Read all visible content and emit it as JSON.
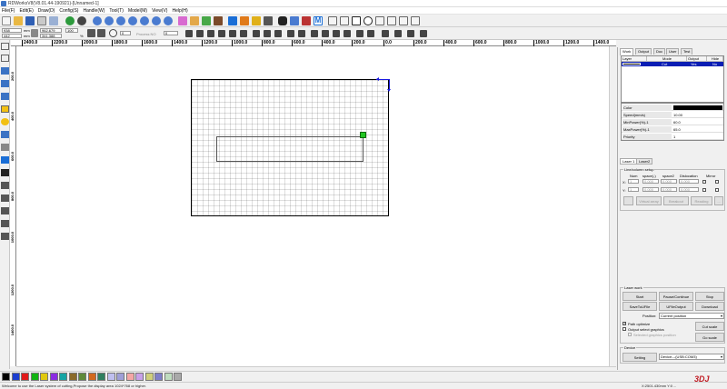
{
  "window": {
    "title": "RDWorksV8(V8.01.44-190921)-[Unnamed-1]"
  },
  "menu": [
    "File(F)",
    "Edit(E)",
    "Draw(D)",
    "Config(S)",
    "Handle(W)",
    "Tool(T)",
    "Model(M)",
    "View(V)",
    "Help(H)"
  ],
  "toolbar2": {
    "pos_x": "938",
    "pos_y": "442",
    "unit1": "mm",
    "unit2": "mm",
    "size_x": "962.679",
    "size_y": "341.388",
    "pct_x": "100",
    "pct_y": "%",
    "rotate_value": "0",
    "process_no_label": "Process NO",
    "process_no_value": "0"
  },
  "hruler": [
    "2400.0",
    "2200.0",
    "2000.0",
    "1800.0",
    "1600.0",
    "1400.0",
    "1200.0",
    "1000.0",
    "800.0",
    "600.0",
    "400.0",
    "200.0",
    "0.0",
    "200.0",
    "400.0",
    "600.0",
    "800.0",
    "1000.0",
    "1200.0",
    "1400.0"
  ],
  "vruler": [
    "200.0",
    "400.0",
    "600.0",
    "800.0",
    "1000.0",
    "1200.0",
    "1400.0"
  ],
  "tabs": [
    "Work",
    "Output",
    "Doc",
    "User",
    "Test"
  ],
  "layer_table": {
    "headers": [
      "Layer",
      "Mode",
      "Output",
      "Hide"
    ],
    "row": {
      "mode": "Cut",
      "output": "Yes",
      "hide": "No"
    }
  },
  "props": [
    {
      "key": "Color",
      "value": ""
    },
    {
      "key": "Speed(mm/s)",
      "value": "10.00"
    },
    {
      "key": "MinPower(%)-1",
      "value": "60.0"
    },
    {
      "key": "MaxPower(%)-1",
      "value": "65.0"
    },
    {
      "key": "Priority",
      "value": "1"
    }
  ],
  "layer_tabs": [
    "Laser 1",
    "Laser2"
  ],
  "array": {
    "title": "Line/column setup",
    "headers": [
      "Num",
      "space(-)",
      "space2",
      "Dislocation",
      "Mirror"
    ],
    "row_x": {
      "label": "X:",
      "num": "1",
      "space": "0.000",
      "space2": "0.000",
      "dis": "0.000"
    },
    "row_y": {
      "label": "Y:",
      "num": "1",
      "space": "0.000",
      "space2": "0.000",
      "dis": "0.000"
    },
    "buttons": [
      "Virtual array",
      "Breakout",
      "Reading",
      "..."
    ]
  },
  "laserwork": {
    "title": "Laser work",
    "start": "Start",
    "pause": "Pause/Continue",
    "stop": "Stop",
    "savetofile": "SaveToUFile",
    "ufileoutput": "UFileOutput",
    "download": "Download",
    "position_label": "Position:",
    "position_value": "Current position",
    "path_optimize": "Path optimize",
    "output_select": "Output select graphics",
    "selected_position": "Selected graphics position",
    "cut_scale": "Cut scale",
    "go_scale": "Go scale"
  },
  "device": {
    "title": "Device",
    "setting": "Setting",
    "port": "Device---(USB:COM3)"
  },
  "status": {
    "message": "Welcome to use the Laser system of cutting,Propose the display area 1024*768 or higher.",
    "coords": "X:2501.430mm Y:0 ..."
  },
  "watermark": "3DJ",
  "colors": {
    "accent_blue": "#0a1eb4",
    "selection_handle": "#22c422",
    "palette": [
      "#000000",
      "#1a3ccf",
      "#e01a1a",
      "#12b312",
      "#e0c90d",
      "#8b2be2",
      "#15a4a4",
      "#8a6a2a",
      "#5d8a3a",
      "#d2691e",
      "#2f7f5f",
      "#bfbfef",
      "#9f9fd7",
      "#f4a6a6",
      "#c8a0e8",
      "#cfcf7a",
      "#7f7fc8",
      "#bfdcbf",
      "#a9a9a9"
    ]
  }
}
